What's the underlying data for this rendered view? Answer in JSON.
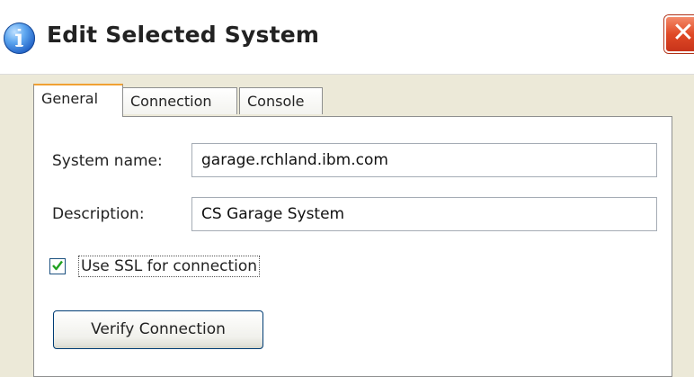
{
  "window": {
    "title": "Edit Selected System",
    "close_symbol": "✕",
    "icon": "info-icon",
    "accent_color": "#2262c6",
    "close_color": "#e04a26"
  },
  "tabs": [
    {
      "label": "General",
      "active": true
    },
    {
      "label": "Connection",
      "active": false
    },
    {
      "label": "Console",
      "active": false
    }
  ],
  "general": {
    "system_name_label": "System name:",
    "system_name_value": "garage.rchland.ibm.com",
    "description_label": "Description:",
    "description_value": "CS Garage System",
    "ssl_checkbox_label": "Use SSL for connection",
    "ssl_checked": true,
    "verify_button_label": "Verify Connection"
  }
}
